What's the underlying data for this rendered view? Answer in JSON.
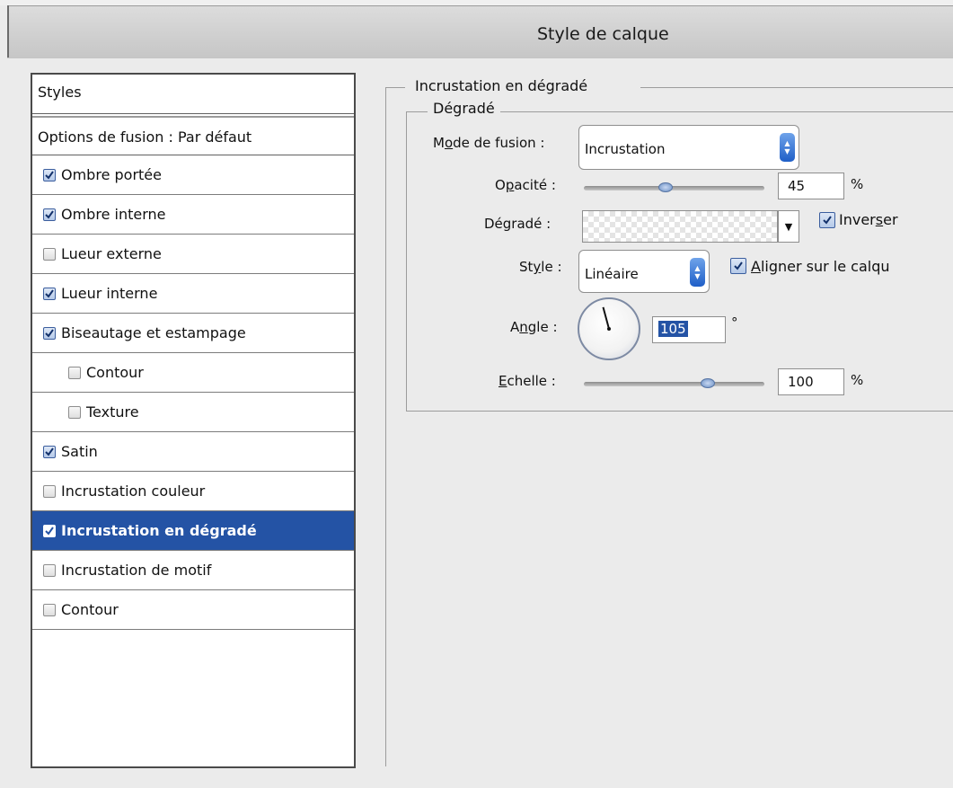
{
  "window": {
    "title": "Style de calque"
  },
  "styles_panel": {
    "header": "Styles",
    "blending_options": "Options de fusion : Par défaut",
    "items": [
      {
        "label": "Ombre portée",
        "checked": true
      },
      {
        "label": "Ombre interne",
        "checked": true
      },
      {
        "label": "Lueur externe",
        "checked": false
      },
      {
        "label": "Lueur interne",
        "checked": true
      },
      {
        "label": "Biseautage et estampage",
        "checked": true
      },
      {
        "label": "Contour",
        "checked": false
      },
      {
        "label": "Texture",
        "checked": false
      },
      {
        "label": "Satin",
        "checked": true
      },
      {
        "label": "Incrustation couleur",
        "checked": false
      },
      {
        "label": "Incrustation en dégradé",
        "checked": true,
        "selected": true
      },
      {
        "label": "Incrustation de motif",
        "checked": false
      },
      {
        "label": "Contour",
        "checked": false
      }
    ]
  },
  "gradient_overlay": {
    "section_title": "Incrustation en dégradé",
    "group_title": "Dégradé",
    "blend_mode": {
      "label_pre": "M",
      "label_u": "o",
      "label_post": "de de fusion :",
      "value": "Incrustation"
    },
    "opacity": {
      "label_pre": "O",
      "label_u": "p",
      "label_post": "acité :",
      "value": "45",
      "unit": "%",
      "level": 0.45
    },
    "gradient": {
      "label": "Dégradé :",
      "reverse_pre": "Inver",
      "reverse_u": "s",
      "reverse_post": "er",
      "reverse_checked": true
    },
    "style": {
      "label_pre": "St",
      "label_u": "y",
      "label_post": "le :",
      "value": "Linéaire",
      "align_u": "A",
      "align_post": "ligner sur le calqu",
      "align_checked": true
    },
    "angle": {
      "label_pre": "A",
      "label_u": "n",
      "label_post": "gle :",
      "value": "105",
      "unit": "°",
      "degrees": 105
    },
    "scale": {
      "label_u": "E",
      "label_post": "chelle :",
      "value": "100",
      "unit": "%",
      "level": 0.68
    }
  },
  "colors": {
    "selection": "#2453a5",
    "accent": "#1f5fc7"
  }
}
